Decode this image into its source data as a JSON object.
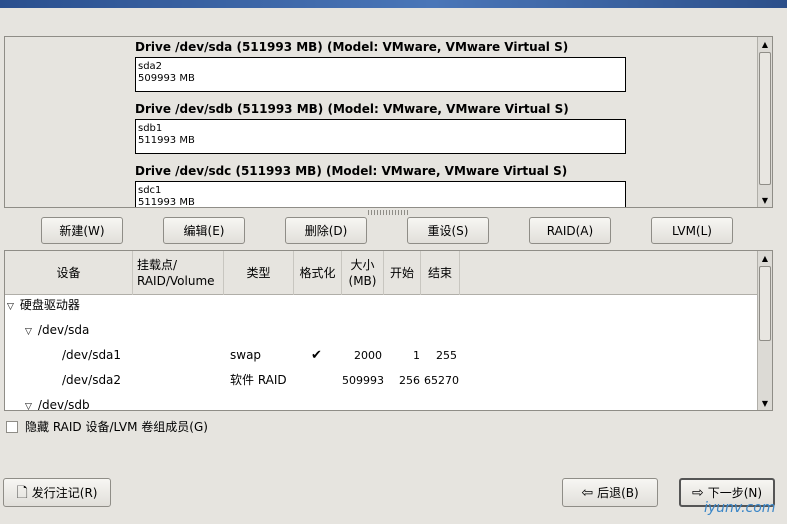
{
  "drives": [
    {
      "title": "Drive /dev/sda (511993 MB) (Model: VMware, VMware Virtual S)",
      "part_name": "sda2",
      "part_size": "509993 MB"
    },
    {
      "title": "Drive /dev/sdb (511993 MB) (Model: VMware, VMware Virtual S)",
      "part_name": "sdb1",
      "part_size": "511993 MB"
    },
    {
      "title": "Drive /dev/sdc (511993 MB) (Model: VMware, VMware Virtual S)",
      "part_name": "sdc1",
      "part_size": "511993 MB"
    }
  ],
  "actions": {
    "new": "新建(W)",
    "edit": "编辑(E)",
    "delete": "删除(D)",
    "reset": "重设(S)",
    "raid": "RAID(A)",
    "lvm": "LVM(L)"
  },
  "table": {
    "headers": {
      "device": "设备",
      "mount": "挂载点/\nRAID/Volume",
      "type": "类型",
      "format": "格式化",
      "size": "大小\n(MB)",
      "start": "开始",
      "end": "结束"
    },
    "rows": [
      {
        "device": "硬盘驱动器",
        "mount": "",
        "type": "",
        "format": "",
        "size": "",
        "start": "",
        "end": ""
      },
      {
        "device": "/dev/sda",
        "mount": "",
        "type": "",
        "format": "",
        "size": "",
        "start": "",
        "end": ""
      },
      {
        "device": "/dev/sda1",
        "mount": "",
        "type": "swap",
        "format": "✔",
        "size": "2000",
        "start": "1",
        "end": "255"
      },
      {
        "device": "/dev/sda2",
        "mount": "",
        "type": "软件 RAID",
        "format": "",
        "size": "509993",
        "start": "256",
        "end": "65270"
      },
      {
        "device": "/dev/sdb",
        "mount": "",
        "type": "",
        "format": "",
        "size": "",
        "start": "",
        "end": ""
      }
    ]
  },
  "hide_raid_label": "隐藏 RAID 设备/LVM 卷组成员(G)",
  "footer": {
    "release_notes": "发行注记(R)",
    "back": "后退(B)",
    "next": "下一步(N)"
  },
  "watermark": "iyunv.com"
}
